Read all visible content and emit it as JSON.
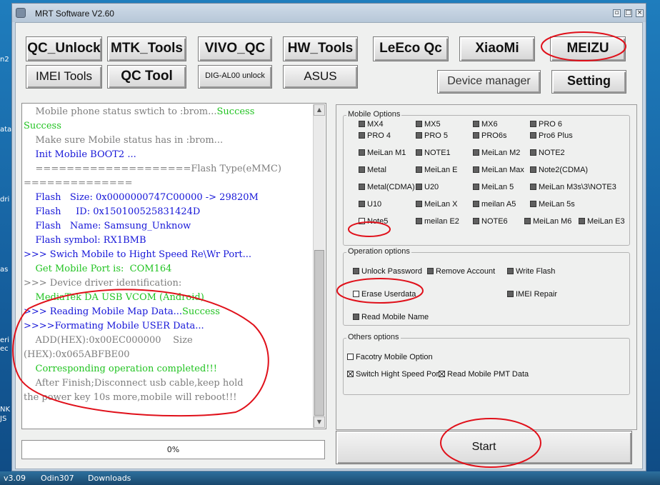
{
  "window": {
    "title": "MRT Software V2.60"
  },
  "desktop": {
    "taskbar_items": [
      "v3.09",
      "Odin307",
      "Downloads"
    ],
    "side_fragments": [
      "n2",
      "ata",
      "dri",
      "as",
      "eri",
      "ec",
      "NK",
      "JS"
    ]
  },
  "toolbar": {
    "row1": [
      "QC_Unlock",
      "MTK_Tools",
      "VIVO_QC",
      "HW_Tools",
      "LeEco Qc",
      "XiaoMi",
      "MEIZU"
    ],
    "row2": [
      "IMEI Tools",
      "QC Tool",
      "DIG-AL00 unlock",
      "ASUS"
    ],
    "device_manager": "Device manager",
    "setting": "Setting"
  },
  "log": [
    {
      "text": "    Mobile phone status swtich to :brom...",
      "color": "gray",
      "suffix": "Success",
      "suffix_color": "green"
    },
    {
      "text": "Success",
      "color": "green"
    },
    {
      "text": "    Make sure Mobile status has in :brom...",
      "color": "gray"
    },
    {
      "text": "    Init Mobile BOOT2 ...",
      "color": "blue"
    },
    {
      "text": "    ====================Flash Type(eMMC)",
      "color": "gray"
    },
    {
      "text": "==============",
      "color": "gray"
    },
    {
      "text": "    Flash   Size: 0x0000000747C00000 -> 29820M",
      "color": "blue"
    },
    {
      "text": "    Flash     ID: 0x150100525831424D",
      "color": "blue"
    },
    {
      "text": "    Flash   Name: Samsung_Unknow",
      "color": "blue"
    },
    {
      "text": "    Flash symbol: RX1BMB",
      "color": "blue"
    },
    {
      "text": ">>> Swich Mobile to Hight Speed Re\\Wr Port...",
      "color": "blue"
    },
    {
      "text": "    Get Mobile Port is:  COM164",
      "color": "green"
    },
    {
      "text": ">>> Device driver identification:",
      "color": "gray"
    },
    {
      "text": "    MediaTek DA USB VCOM (Android)",
      "color": "green"
    },
    {
      "text": ">>> Reading Mobile Map Data...",
      "color": "blue",
      "suffix": "Success",
      "suffix_color": "green"
    },
    {
      "text": ">>>>Formating Mobile USER Data...",
      "color": "blue"
    },
    {
      "text": "    ADD(HEX):0x00EC000000    Size",
      "color": "gray"
    },
    {
      "text": "(HEX):0x065ABFBE00",
      "color": "gray"
    },
    {
      "text": "    Corresponding operation completed!!!",
      "color": "green"
    },
    {
      "text": "    After Finish;Disconnect usb cable,keep hold",
      "color": "gray"
    },
    {
      "text": "the power key 10s more,mobile will reboot!!!",
      "color": "gray"
    }
  ],
  "progress": {
    "label": "0%",
    "value": 0
  },
  "mobile_options": {
    "label": "Mobile Options",
    "items": [
      {
        "label": "MX4",
        "checked": false
      },
      {
        "label": "MX5",
        "checked": false
      },
      {
        "label": "MX6",
        "checked": false
      },
      {
        "label": "PRO 6",
        "checked": false
      },
      {
        "label": "PRO 4",
        "checked": false
      },
      {
        "label": "PRO 5",
        "checked": false
      },
      {
        "label": "PRO6s",
        "checked": false
      },
      {
        "label": "Pro6 Plus",
        "checked": false
      },
      {
        "label": "MeiLan M1",
        "checked": false
      },
      {
        "label": "NOTE1",
        "checked": false
      },
      {
        "label": "MeiLan M2",
        "checked": false
      },
      {
        "label": "NOTE2",
        "checked": false
      },
      {
        "label": "Metal",
        "checked": false
      },
      {
        "label": "MeiLan E",
        "checked": false
      },
      {
        "label": "MeiLan Max",
        "checked": false
      },
      {
        "label": "Note2(CDMA)",
        "checked": false
      },
      {
        "label": "Metal(CDMA)",
        "checked": false
      },
      {
        "label": "U20",
        "checked": false
      },
      {
        "label": "MeiLan 5",
        "checked": false
      },
      {
        "label": "MeiLan M3s\\3\\NOTE3",
        "checked": false
      },
      {
        "label": "U10",
        "checked": false
      },
      {
        "label": "MeiLan X",
        "checked": false
      },
      {
        "label": "meilan A5",
        "checked": false
      },
      {
        "label": "MeiLan 5s",
        "checked": false
      },
      {
        "label": "Note5",
        "checked": false
      },
      {
        "label": "meilan E2",
        "checked": false
      },
      {
        "label": "NOTE6",
        "checked": false
      },
      {
        "label": "MeiLan M6",
        "checked": false
      },
      {
        "label": "MeiLan E3",
        "checked": false
      }
    ]
  },
  "operation_options": {
    "label": "Operation options",
    "items": [
      {
        "label": "Unlock Password",
        "checked": false
      },
      {
        "label": "Remove Account",
        "checked": false
      },
      {
        "label": "Write Flash",
        "checked": false
      },
      {
        "label": "Erase Userdata",
        "checked": false
      },
      {
        "label": "IMEI Repair",
        "checked": false
      },
      {
        "label": "Read Mobile Name",
        "checked": false
      }
    ]
  },
  "others_options": {
    "label": "Others options",
    "items": [
      {
        "label": "Facotry Mobile Option",
        "checked": false
      },
      {
        "label": "Switch Hight Speed Por",
        "checked": true
      },
      {
        "label": "Read Mobile PMT Data",
        "checked": true
      }
    ]
  },
  "start_button": "Start",
  "colors": {
    "gray": "#7d7d7d",
    "green": "#21c321",
    "blue": "#1515d8",
    "annotation": "#e0101a",
    "progress": "#3fb34a"
  }
}
